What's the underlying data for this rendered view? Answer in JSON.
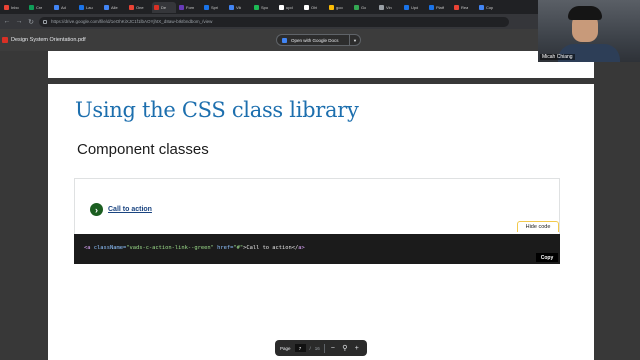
{
  "browser": {
    "tabs": [
      {
        "label": "Inbo",
        "color": "#ea4335",
        "active": false
      },
      {
        "label": "Cre",
        "color": "#0f9d58",
        "active": false
      },
      {
        "label": "Ad",
        "color": "#4285f4",
        "active": false
      },
      {
        "label": "Lau",
        "color": "#1a73e8",
        "active": false
      },
      {
        "label": "Alle",
        "color": "#4285f4",
        "active": false
      },
      {
        "label": "One",
        "color": "#ea4335",
        "active": false
      },
      {
        "label": "De",
        "color": "#d93025",
        "active": true
      },
      {
        "label": "Forn",
        "color": "#673ab7",
        "active": false
      },
      {
        "label": "Spri",
        "color": "#1a73e8",
        "active": false
      },
      {
        "label": "Vik",
        "color": "#4285f4",
        "active": false
      },
      {
        "label": "Spo",
        "color": "#1db954",
        "active": false
      },
      {
        "label": "upd",
        "color": "#ffffff",
        "active": false
      },
      {
        "label": "Oht",
        "color": "#ffffff",
        "active": false
      },
      {
        "label": "goo",
        "color": "#fbbc05",
        "active": false
      },
      {
        "label": "Go",
        "color": "#34a853",
        "active": false
      },
      {
        "label": "Vin",
        "color": "#9aa0a6",
        "active": false
      },
      {
        "label": "Upd",
        "color": "#1a73e8",
        "active": false
      },
      {
        "label": "Platf",
        "color": "#1a73e8",
        "active": false
      },
      {
        "label": "Rea",
        "color": "#ea4335",
        "active": false
      },
      {
        "label": "Cop",
        "color": "#4285f4",
        "active": false
      }
    ],
    "url": "https://drive.google.com/file/d/1eOhKiXJC1f1lbAOYjhtX_d8aw-bIkIbndbom_/view"
  },
  "pdf_viewer": {
    "file_name": "Design System Orientation.pdf",
    "open_with_label": "Open with Google Docs",
    "page_label": "Page",
    "current_page": "7",
    "page_separator": "/",
    "total_pages": "16"
  },
  "document": {
    "heading": "Using the CSS class library",
    "subheading": "Component classes",
    "example_link_label": "Call to action",
    "hide_code_label": "Hide code",
    "code": {
      "open_tag": "<a",
      "class_attr": "className=",
      "class_value": "\"vads-c-action-link--green\"",
      "href_attr": "href=",
      "href_value": "\"#\"",
      "text": ">Call to action</",
      "close_tag": "a>"
    },
    "copy_label": "Copy"
  },
  "webcam": {
    "participant_name": "Micah Chiang"
  }
}
